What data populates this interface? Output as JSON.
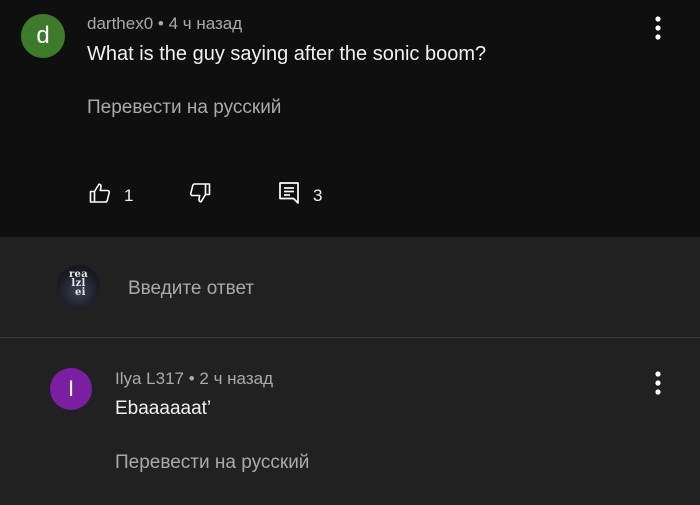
{
  "comment": {
    "avatar_letter": "d",
    "author": "darthex0",
    "separator": " • ",
    "time": "4 ч назад",
    "text": "What is the guy saying after the sonic boom?",
    "translate_label": "Перевести на русский",
    "like_count": "1",
    "reply_count": "3"
  },
  "reply_box": {
    "placeholder": "Введите ответ",
    "avatar_text": "rea\nlzl\n ei"
  },
  "reply": {
    "avatar_letter": "I",
    "author": "Ilya L317",
    "separator": " • ",
    "time": "2 ч назад",
    "text": "Ebaaaaaat’",
    "translate_label": "Перевести на русский"
  },
  "colors": {
    "comment_bg": "#0f0f0f",
    "page_bg": "#212121",
    "avatar_d": "#3d7a2a",
    "avatar_i": "#7b1fa2",
    "secondary_text": "#aaaaaa"
  },
  "icons": {
    "like": "thumbs-up-icon",
    "dislike": "thumbs-down-icon",
    "replies": "comment-icon",
    "menu": "more-vert-icon"
  }
}
